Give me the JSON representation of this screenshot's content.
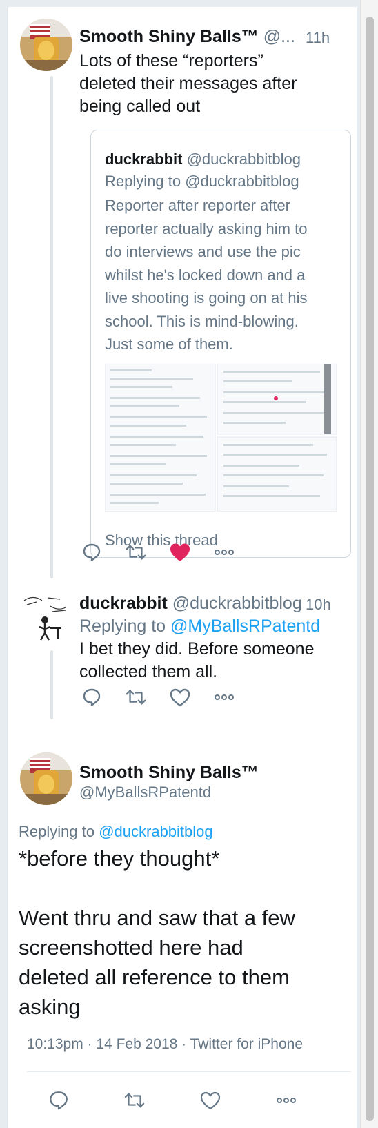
{
  "tweets": [
    {
      "name": "Smooth Shiny Balls™",
      "handle": "@...",
      "time": "11h",
      "text_lines": [
        "Lots of these “reporters”",
        "deleted their messages after",
        "being called out"
      ],
      "quoted": {
        "name": "duckrabbit",
        "handle": "@duckrabbitblog",
        "replying_prefix": "Replying to",
        "replying_handle": "@duckrabbitblog",
        "text_lines": [
          "Reporter after reporter after",
          "reporter actually asking him to",
          "do interviews and use the pic",
          "whilst he's locked down and a",
          "live shooting is going on at his",
          "school.  This is mind-blowing.",
          "Just some of them."
        ],
        "show_thread": "Show this thread"
      },
      "liked": true
    },
    {
      "name": "duckrabbit",
      "handle": "@duckrabbitblog",
      "time": "10h",
      "replying_prefix": "Replying to",
      "replying_handle": "@MyBallsRPatentd",
      "text_lines": [
        "I bet they did. Before someone",
        "collected them all."
      ],
      "liked": false
    },
    {
      "name": "Smooth Shiny Balls™",
      "handle": "@MyBallsRPatentd",
      "replying_prefix": "Replying to",
      "replying_handle": "@duckrabbitblog",
      "text_lines": [
        "*before they thought*",
        "",
        "Went thru and saw that a few",
        "screenshotted here had",
        "deleted all reference to them",
        "asking"
      ],
      "meta": "10:13pm · 14 Feb 2018 · Twitter for iPhone"
    }
  ],
  "icons": [
    "reply-icon",
    "retweet-icon",
    "like-icon",
    "more-icon"
  ],
  "colors": {
    "accent": "#1da1f2",
    "like": "#e0245e",
    "muted": "#657786",
    "text": "#14171a"
  }
}
